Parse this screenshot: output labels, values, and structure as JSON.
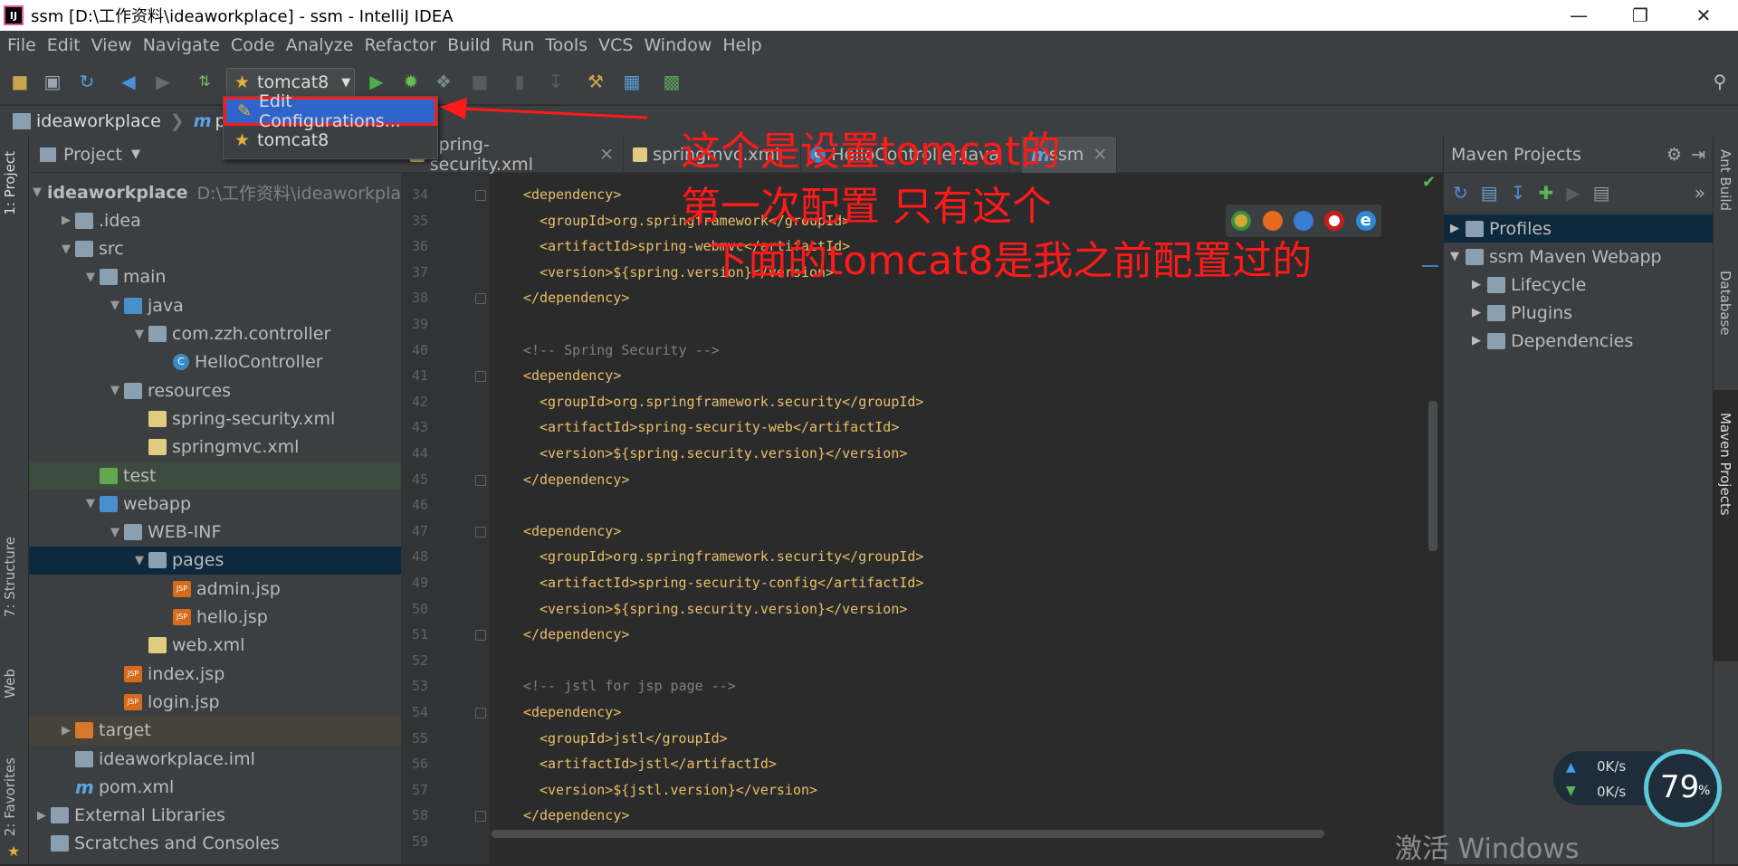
{
  "window": {
    "title": "ssm [D:\\工作资料\\ideaworkplace] - ssm - IntelliJ IDEA",
    "app_icon_label": "IJ"
  },
  "menu": [
    "File",
    "Edit",
    "View",
    "Navigate",
    "Code",
    "Analyze",
    "Refactor",
    "Build",
    "Run",
    "Tools",
    "VCS",
    "Window",
    "Help"
  ],
  "toolbar": {
    "run_config": "tomcat8"
  },
  "popup": {
    "items": [
      "Edit Configurations...",
      "tomcat8"
    ]
  },
  "navbar": {
    "root": "ideaworkplace",
    "file": "po"
  },
  "left_tabs": {
    "project": "1: Project",
    "structure": "7: Structure",
    "web": "Web",
    "favorites": "2: Favorites"
  },
  "project_panel": {
    "title": "Project",
    "tree": [
      {
        "label": "ideaworkplace",
        "path": "D:\\工作资料\\ideaworkplac"
      },
      {
        "label": ".idea"
      },
      {
        "label": "src"
      },
      {
        "label": "main"
      },
      {
        "label": "java"
      },
      {
        "label": "com.zzh.controller"
      },
      {
        "label": "HelloController"
      },
      {
        "label": "resources"
      },
      {
        "label": "spring-security.xml"
      },
      {
        "label": "springmvc.xml"
      },
      {
        "label": "test"
      },
      {
        "label": "webapp"
      },
      {
        "label": "WEB-INF"
      },
      {
        "label": "pages"
      },
      {
        "label": "admin.jsp"
      },
      {
        "label": "hello.jsp"
      },
      {
        "label": "web.xml"
      },
      {
        "label": "index.jsp"
      },
      {
        "label": "login.jsp"
      },
      {
        "label": "target"
      },
      {
        "label": "ideaworkplace.iml"
      },
      {
        "label": "pom.xml"
      },
      {
        "label": "External Libraries"
      },
      {
        "label": "Scratches and Consoles"
      }
    ]
  },
  "editor_tabs": [
    "spring-security.xml",
    "springmvc.xml",
    "HelloController.java",
    "ssm"
  ],
  "code_lines": [
    {
      "n": "34",
      "t": "<dependency>"
    },
    {
      "n": "35",
      "t": "<groupId>org.springframework</groupId>"
    },
    {
      "n": "36",
      "t": "<artifactId>spring-webmvc</artifactId>"
    },
    {
      "n": "37",
      "t": "<version>${spring.version}</version>"
    },
    {
      "n": "38",
      "t": "</dependency>"
    },
    {
      "n": "39",
      "t": ""
    },
    {
      "n": "40",
      "t": "<!-- Spring Security -->"
    },
    {
      "n": "41",
      "t": "<dependency>"
    },
    {
      "n": "42",
      "t": "<groupId>org.springframework.security</groupId>"
    },
    {
      "n": "43",
      "t": "<artifactId>spring-security-web</artifactId>"
    },
    {
      "n": "44",
      "t": "<version>${spring.security.version}</version>"
    },
    {
      "n": "45",
      "t": "</dependency>"
    },
    {
      "n": "46",
      "t": ""
    },
    {
      "n": "47",
      "t": "<dependency>"
    },
    {
      "n": "48",
      "t": "<groupId>org.springframework.security</groupId>"
    },
    {
      "n": "49",
      "t": "<artifactId>spring-security-config</artifactId>"
    },
    {
      "n": "50",
      "t": "<version>${spring.security.version}</version>"
    },
    {
      "n": "51",
      "t": "</dependency>"
    },
    {
      "n": "52",
      "t": ""
    },
    {
      "n": "53",
      "t": "<!-- jstl for jsp page -->"
    },
    {
      "n": "54",
      "t": "<dependency>"
    },
    {
      "n": "55",
      "t": "<groupId>jstl</groupId>"
    },
    {
      "n": "56",
      "t": "<artifactId>jstl</artifactId>"
    },
    {
      "n": "57",
      "t": "<version>${jstl.version}</version>"
    },
    {
      "n": "58",
      "t": "</dependency>"
    },
    {
      "n": "59",
      "t": ""
    }
  ],
  "maven_panel": {
    "title": "Maven Projects",
    "tree": [
      "Profiles",
      "ssm Maven Webapp",
      "Lifecycle",
      "Plugins",
      "Dependencies"
    ]
  },
  "right_tabs": {
    "ant": "Ant Build",
    "database": "Database",
    "maven": "Maven Projects"
  },
  "annotation": {
    "line1": "这个是设置tomcat的",
    "line2": "第一次配置 只有这个",
    "line3": "下面的tomcat8是我之前配置过的"
  },
  "net_widget": {
    "up": "0K/s",
    "down": "0K/s",
    "percent": "79",
    "unit": "%"
  },
  "watermark": "激活 Windows",
  "colors": {
    "accent": "#2f65ca",
    "annotation": "#ff1a1a",
    "selection": "#0d293e"
  }
}
